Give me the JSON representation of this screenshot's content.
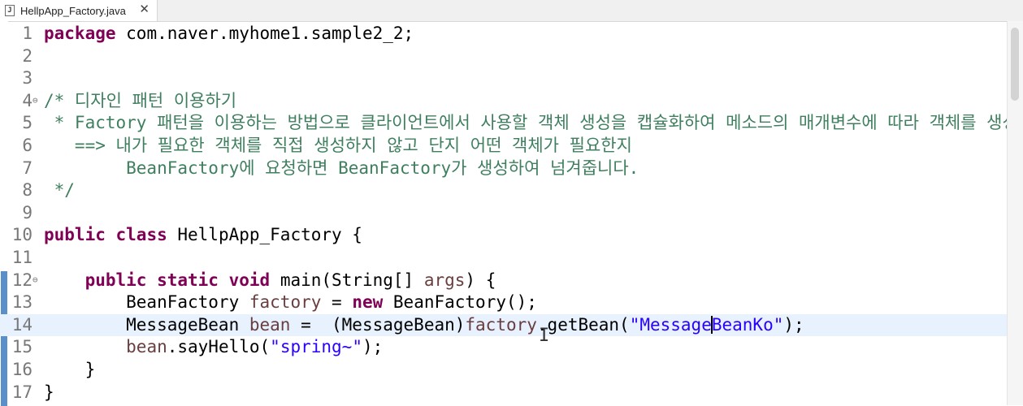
{
  "tab": {
    "file_icon": "J",
    "title": "HellpApp_Factory.java",
    "close": "✕"
  },
  "editor": {
    "lines": [
      {
        "n": "1",
        "t": [
          [
            "kw",
            "package"
          ],
          [
            "",
            " com.naver.myhome1.sample2_2;"
          ]
        ]
      },
      {
        "n": "2",
        "t": []
      },
      {
        "n": "3",
        "t": []
      },
      {
        "n": "4",
        "fold": "⊖",
        "t": [
          [
            "cm",
            "/* 디자인 패턴 이용하기"
          ]
        ]
      },
      {
        "n": "5",
        "t": [
          [
            "cm",
            " * Factory 패턴을 이용하는 방법으로 클라이언트에서 사용할 객체 생성을 캡슐화하여 메소드의 매개변수에 따라 객체를 생성"
          ]
        ]
      },
      {
        "n": "6",
        "t": [
          [
            "cm",
            "   ==> 내가 필요한 객체를 직접 생성하지 않고 단지 어떤 객체가 필요한지"
          ]
        ]
      },
      {
        "n": "7",
        "t": [
          [
            "cm",
            "        BeanFactory에 요청하면 BeanFactory가 생성하여 넘겨줍니다."
          ]
        ]
      },
      {
        "n": "8",
        "t": [
          [
            "cm",
            " */"
          ]
        ]
      },
      {
        "n": "9",
        "t": []
      },
      {
        "n": "10",
        "t": [
          [
            "kw",
            "public"
          ],
          [
            "",
            " "
          ],
          [
            "kw",
            "class"
          ],
          [
            "",
            " HellpApp_Factory {"
          ]
        ]
      },
      {
        "n": "11",
        "t": []
      },
      {
        "n": "12",
        "fold": "⊖",
        "t": [
          [
            "",
            "    "
          ],
          [
            "kw",
            "public"
          ],
          [
            "",
            " "
          ],
          [
            "kw",
            "static"
          ],
          [
            "",
            " "
          ],
          [
            "kw",
            "void"
          ],
          [
            "",
            " main(String[] "
          ],
          [
            "fld",
            "args"
          ],
          [
            "",
            ") {"
          ]
        ]
      },
      {
        "n": "13",
        "t": [
          [
            "",
            "        BeanFactory "
          ],
          [
            "fld",
            "factory"
          ],
          [
            "",
            " = "
          ],
          [
            "kw",
            "new"
          ],
          [
            "",
            " BeanFactory();"
          ]
        ]
      },
      {
        "n": "14",
        "current": true,
        "t": [
          [
            "",
            "        MessageBean "
          ],
          [
            "fld",
            "bean"
          ],
          [
            "",
            " =  (MessageBean)"
          ],
          [
            "fld",
            "factory"
          ],
          [
            "",
            ".getBean("
          ],
          [
            "st",
            "\"Message"
          ],
          [
            "caret",
            ""
          ],
          [
            "st",
            "BeanKo\""
          ],
          [
            "",
            ");"
          ]
        ]
      },
      {
        "n": "15",
        "t": [
          [
            "",
            "        "
          ],
          [
            "fld",
            "bean"
          ],
          [
            "",
            ".sayHello("
          ],
          [
            "st",
            "\"spring~\""
          ],
          [
            "",
            ");"
          ]
        ]
      },
      {
        "n": "16",
        "t": [
          [
            "",
            "    }"
          ]
        ]
      },
      {
        "n": "17",
        "t": [
          [
            "",
            "}"
          ]
        ]
      }
    ]
  },
  "cursor": {
    "icon": "text-cursor-icon",
    "glyph": "I"
  }
}
